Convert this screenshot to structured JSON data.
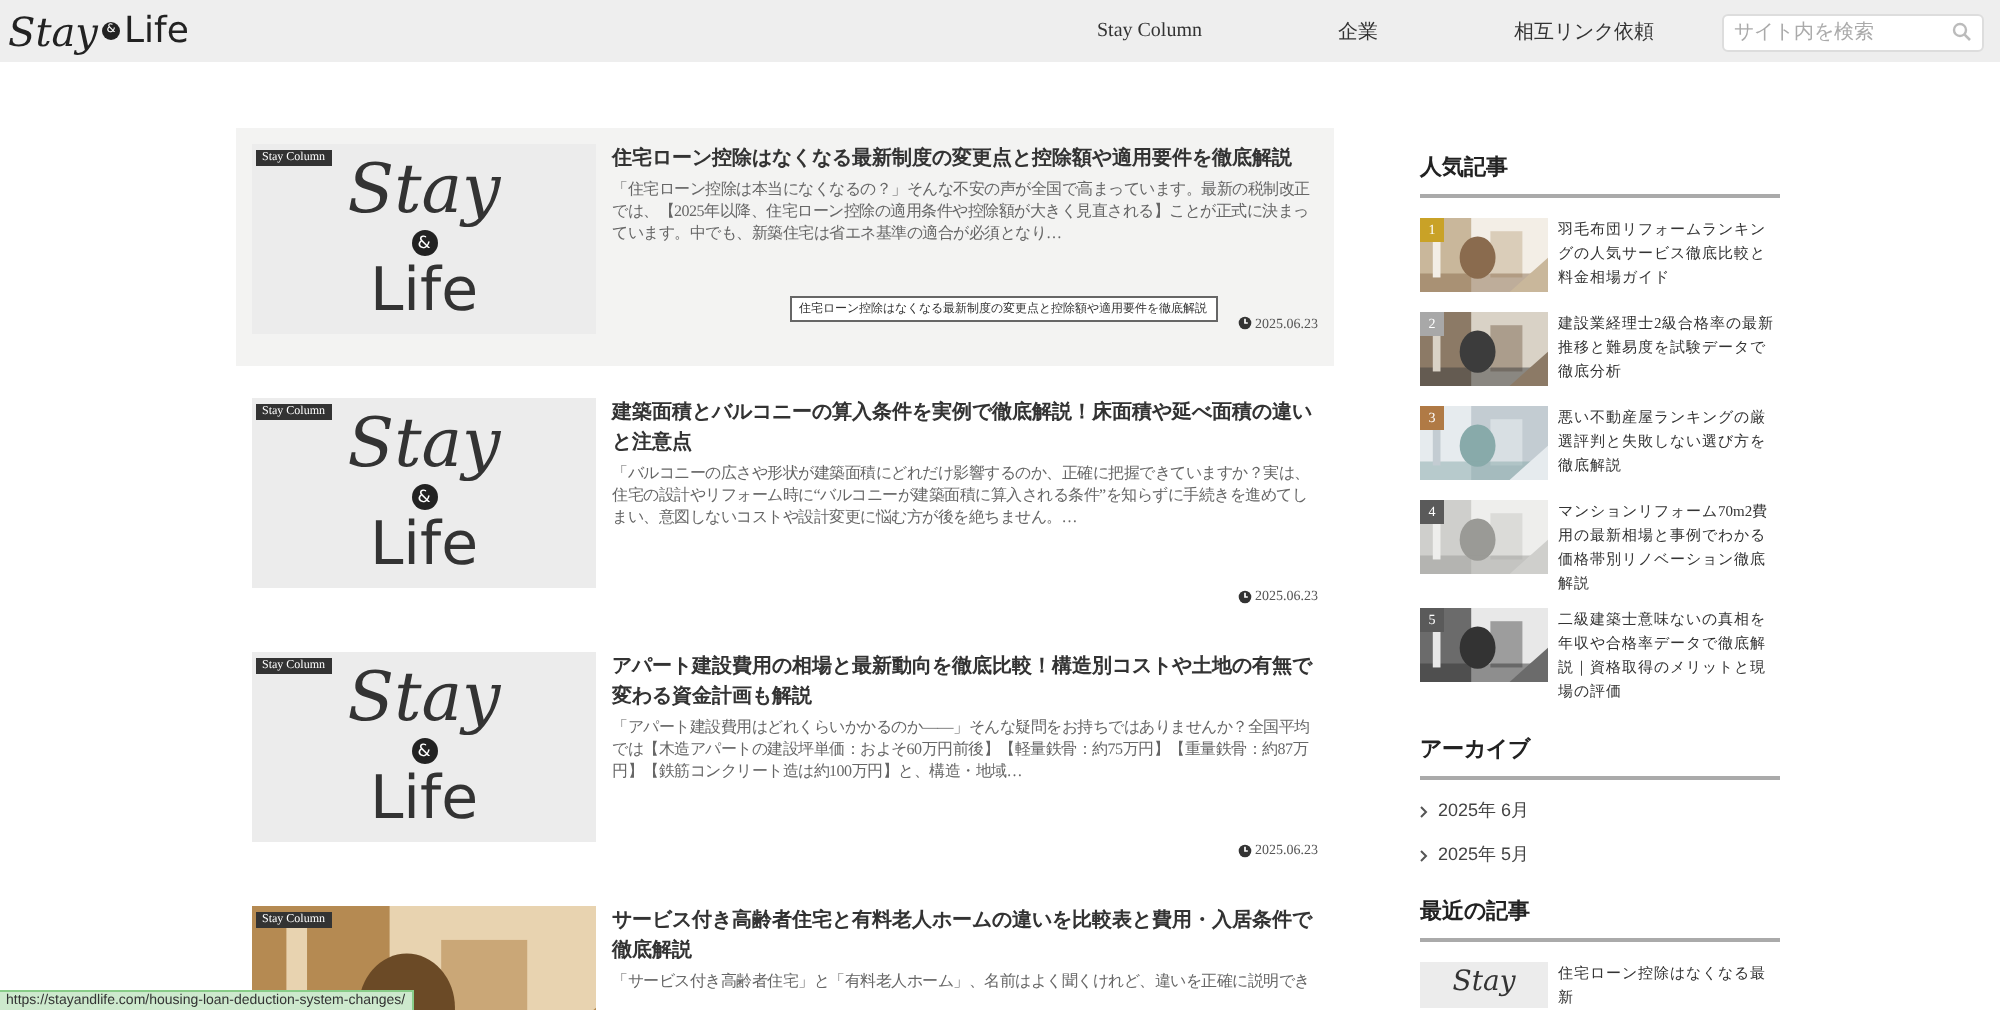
{
  "header": {
    "logo": [
      "Stay",
      "&",
      "Life"
    ],
    "nav": [
      "Stay Column",
      "企業",
      "相互リンク依頼"
    ],
    "search": {
      "placeholder": "サイト内を検索"
    }
  },
  "articles": [
    {
      "hovered": true,
      "category": "Stay Column",
      "thumbnail": {
        "kind": "logo",
        "lines": [
          "Stay",
          "&",
          "Life"
        ]
      },
      "title": "住宅ローン控除はなくなる最新制度の変更点と控除額や適用要件を徹底解説",
      "excerpt": "「住宅ローン控除は本当になくなるの？」そんな不安の声が全国で高まっています。最新の税制改正では、【2025年以降、住宅ローン控除の適用条件や控除額が大きく見直される】ことが正式に決まっています。中でも、新築住宅は省エネ基準の適合が必須となり…",
      "tooltip": "住宅ローン控除はなくなる最新制度の変更点と控除額や適用要件を徹底解説",
      "date": "2025.06.23"
    },
    {
      "hovered": false,
      "category": "Stay Column",
      "thumbnail": {
        "kind": "logo",
        "lines": [
          "Stay",
          "&",
          "Life"
        ]
      },
      "title": "建築面積とバルコニーの算入条件を実例で徹底解説！床面積や延べ面積の違いと注意点",
      "excerpt": "「バルコニーの広さや形状が建築面積にどれだけ影響するのか、正確に把握できていますか？実は、住宅の設計やリフォーム時に“バルコニーが建築面積に算入される条件”を知らずに手続きを進めてしまい、意図しないコストや設計変更に悩む方が後を絶ちません。…",
      "date": "2025.06.23"
    },
    {
      "hovered": false,
      "category": "Stay Column",
      "thumbnail": {
        "kind": "logo",
        "lines": [
          "Stay",
          "&",
          "Life"
        ]
      },
      "title": "アパート建設費用の相場と最新動向を徹底比較！構造別コストや土地の有無で変わる資金計画も解説",
      "excerpt": "「アパート建設費用はどれくらいかかるのか――」そんな疑問をお持ちではありませんか？全国平均では【木造アパートの建設坪単価：およそ60万円前後】【軽量鉄骨：約75万円】【重量鉄骨：約87万円】【鉄筋コンクリート造は約100万円】と、構造・地域…",
      "date": "2025.06.23"
    },
    {
      "hovered": false,
      "category": "Stay Column",
      "title": "サービス付き高齢者住宅と有料老人ホームの違いを比較表と費用・入居条件で徹底解説",
      "excerpt": "「サービス付き高齢者住宅」と「有料老人ホーム」、名前はよく聞くけれど、違いを正確に説明でき"
    }
  ],
  "sidebar": {
    "popular": {
      "heading": "人気記事",
      "items": [
        {
          "rank": "1",
          "color": "#c9a227",
          "title": "羽毛布団リフォームランキングの人気サービス徹底比較と料金相場ガイド"
        },
        {
          "rank": "2",
          "color": "#a8a8a8",
          "title": "建設業経理士2級合格率の最新推移と難易度を試験データで徹底分析"
        },
        {
          "rank": "3",
          "color": "#b07a45",
          "title": "悪い不動産屋ランキングの厳選評判と失敗しない選び方を徹底解説"
        },
        {
          "rank": "4",
          "color": "#5a5a5a",
          "title": "マンションリフォーム70m2費用の最新相場と事例でわかる価格帯別リノベーション徹底解説"
        },
        {
          "rank": "5",
          "color": "#5a5a5a",
          "title": "二級建築士意味ないの真相を年収や合格率データで徹底解説｜資格取得のメリットと現場の評価"
        }
      ]
    },
    "archive": {
      "heading": "アーカイブ",
      "items": [
        "2025年 6月",
        "2025年 5月"
      ]
    },
    "recent": {
      "heading": "最近の記事",
      "items": [
        {
          "thumbnail": "Stay",
          "title": "住宅ローン控除はなくなる最新"
        }
      ]
    }
  },
  "status_bar": "https://stayandlife.com/housing-loan-deduction-system-changes/"
}
